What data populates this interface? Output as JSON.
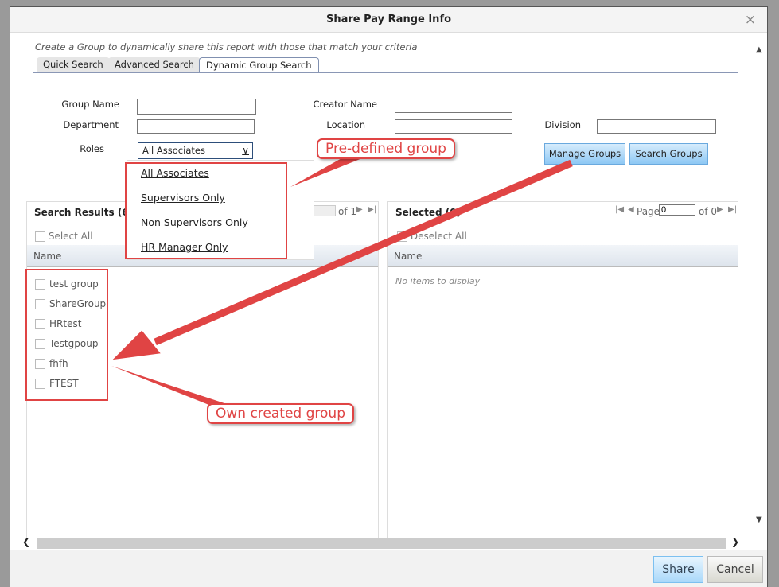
{
  "dialog": {
    "title": "Share Pay Range Info",
    "subtitle": "Create a Group to dynamically share this report with those that match your criteria"
  },
  "tabs": [
    {
      "label": "Quick Search"
    },
    {
      "label": "Advanced Search"
    },
    {
      "label": "Dynamic Group Search",
      "active": true
    }
  ],
  "form": {
    "group_name": {
      "label": "Group Name",
      "value": ""
    },
    "department": {
      "label": "Department",
      "value": ""
    },
    "roles": {
      "label": "Roles",
      "value": "All Associates",
      "options": [
        "All Associates",
        "Supervisors Only",
        "Non Supervisors Only",
        "HR Manager Only"
      ]
    },
    "creator_name": {
      "label": "Creator Name",
      "value": ""
    },
    "location": {
      "label": "Location",
      "value": ""
    },
    "division": {
      "label": "Division",
      "value": ""
    },
    "manage_groups": "Manage Groups",
    "search_groups": "Search Groups"
  },
  "results": {
    "title": "Search Results (6)",
    "select_all": "Select All",
    "column": "Name",
    "pager_of": "of 1",
    "items": [
      "test group",
      "ShareGroup",
      "HRtest",
      "Testgpoup",
      "fhfh",
      "FTEST"
    ]
  },
  "selected": {
    "title": "Selected (0)",
    "deselect_all": "Deselect All",
    "column": "Name",
    "page_label": "Page",
    "page_value": "0",
    "pager_of": "of 0",
    "empty": "No items to display"
  },
  "footer": {
    "share": "Share",
    "cancel": "Cancel"
  },
  "annotations": {
    "predefined": "Pre-defined group",
    "own": "Own created group",
    "color": "#e04444"
  }
}
